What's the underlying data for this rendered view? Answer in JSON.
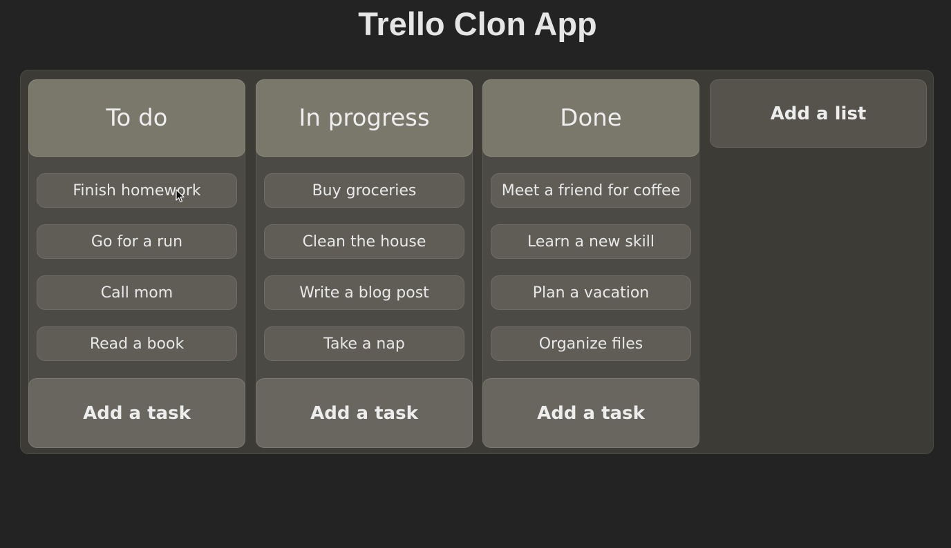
{
  "app": {
    "title": "Trello Clon App"
  },
  "lists": [
    {
      "title": "To do",
      "cards": [
        "Finish homework",
        "Go for a run",
        "Call mom",
        "Read a book"
      ],
      "add_task_label": "Add a task"
    },
    {
      "title": "In progress",
      "cards": [
        "Buy groceries",
        "Clean the house",
        "Write a blog post",
        "Take a nap"
      ],
      "add_task_label": "Add a task"
    },
    {
      "title": "Done",
      "cards": [
        "Meet a friend for coffee",
        "Learn a new skill",
        "Plan a vacation",
        "Organize files"
      ],
      "add_task_label": "Add a task"
    }
  ],
  "add_list": {
    "label": "Add a list"
  },
  "colors": {
    "background": "#232323",
    "board": "#3c3b36",
    "list_header": "#7a776b",
    "card": "#5f5d56",
    "add_task": "#68665e",
    "add_list": "#55534c"
  },
  "icons": {
    "cursor": "mouse-pointer-icon"
  }
}
